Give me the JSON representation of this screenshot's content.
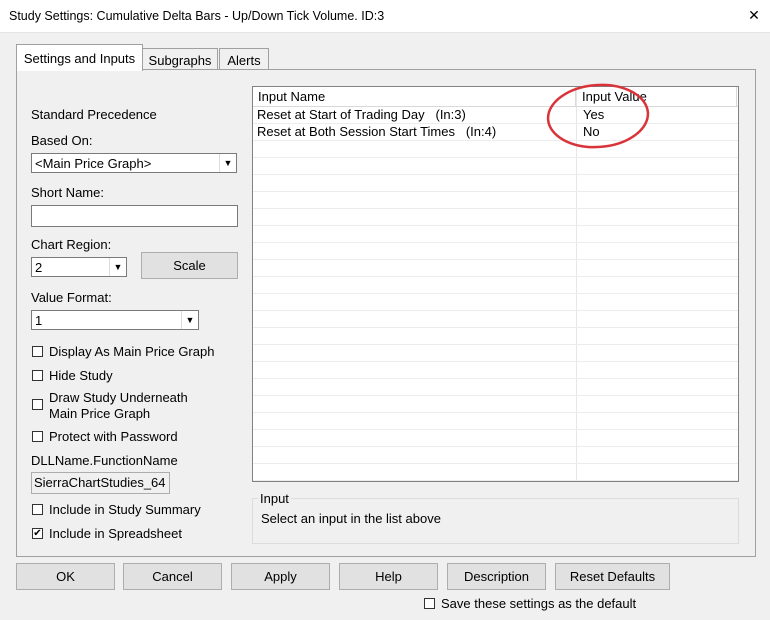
{
  "window": {
    "title": "Study Settings: Cumulative Delta Bars - Up/Down Tick Volume. ID:3",
    "close_glyph": "✕"
  },
  "tabs": [
    {
      "label": "Settings and Inputs",
      "active": true
    },
    {
      "label": "Subgraphs",
      "active": false
    },
    {
      "label": "Alerts",
      "active": false
    }
  ],
  "left": {
    "standard_precedence": "Standard Precedence",
    "based_on_label": "Based On:",
    "based_on_value": "<Main Price Graph>",
    "short_name_label": "Short Name:",
    "short_name_value": "",
    "chart_region_label": "Chart Region:",
    "chart_region_value": "2",
    "scale_button": "Scale",
    "value_format_label": "Value Format:",
    "value_format_value": "1",
    "checkboxes": [
      {
        "label": "Display As Main Price Graph",
        "checked": false
      },
      {
        "label": "Hide Study",
        "checked": false
      },
      {
        "label": "Draw Study Underneath",
        "label2": "Main Price Graph",
        "checked": false
      },
      {
        "label": "Protect with Password",
        "checked": false
      }
    ],
    "dll_label": "DLLName.FunctionName",
    "dll_value": "SierraChartStudies_64",
    "include_summary": {
      "label": "Include in Study Summary",
      "checked": false
    },
    "include_spreadsheet": {
      "label": "Include in Spreadsheet",
      "checked": true
    }
  },
  "grid": {
    "col_name": "Input Name",
    "col_value": "Input Value",
    "rows": [
      {
        "name": "Reset at Start of Trading Day",
        "id": "(In:3)",
        "value": "Yes"
      },
      {
        "name": "Reset at Both Session Start Times",
        "id": "(In:4)",
        "value": "No"
      }
    ],
    "highlight_color": "#d9343a"
  },
  "input_group": {
    "title": "Input",
    "description": "Select an input in the list above"
  },
  "buttons": {
    "ok": "OK",
    "cancel": "Cancel",
    "apply": "Apply",
    "help": "Help",
    "description": "Description",
    "reset_defaults": "Reset Defaults"
  },
  "save_default": {
    "label": "Save these settings as the default",
    "checked": false
  }
}
